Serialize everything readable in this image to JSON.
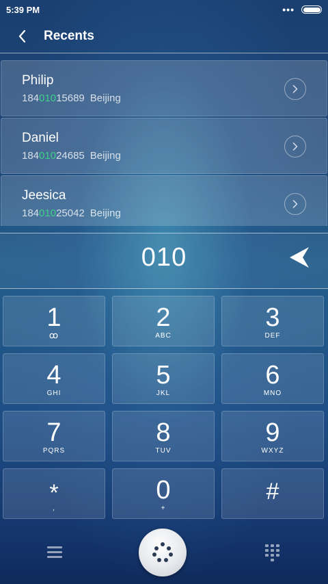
{
  "status_bar": {
    "time": "5:39 PM",
    "dots": "•••"
  },
  "header": {
    "title": "Recents"
  },
  "recents": [
    {
      "name": "Philip",
      "number_prefix": "184",
      "number_match": "010",
      "number_suffix": "15689",
      "city": "Beijing"
    },
    {
      "name": "Daniel",
      "number_prefix": "184",
      "number_match": "010",
      "number_suffix": "24685",
      "city": "Beijing"
    },
    {
      "name": "Jeesica",
      "number_prefix": "184",
      "number_match": "010",
      "number_suffix": "25042",
      "city": "Beijing"
    }
  ],
  "display": {
    "digits": "010"
  },
  "keypad": [
    {
      "digit": "1",
      "letters": "ꝏ"
    },
    {
      "digit": "2",
      "letters": "ABC"
    },
    {
      "digit": "3",
      "letters": "DEF"
    },
    {
      "digit": "4",
      "letters": "GHI"
    },
    {
      "digit": "5",
      "letters": "JKL"
    },
    {
      "digit": "6",
      "letters": "MNO"
    },
    {
      "digit": "7",
      "letters": "PQRS"
    },
    {
      "digit": "8",
      "letters": "TUV"
    },
    {
      "digit": "9",
      "letters": "WXYZ"
    },
    {
      "digit": "*",
      "letters": ","
    },
    {
      "digit": "0",
      "letters": "+"
    },
    {
      "digit": "#",
      "letters": ""
    }
  ],
  "colors": {
    "match_highlight": "#3fd08a",
    "call_button": "#e6e8ec"
  }
}
